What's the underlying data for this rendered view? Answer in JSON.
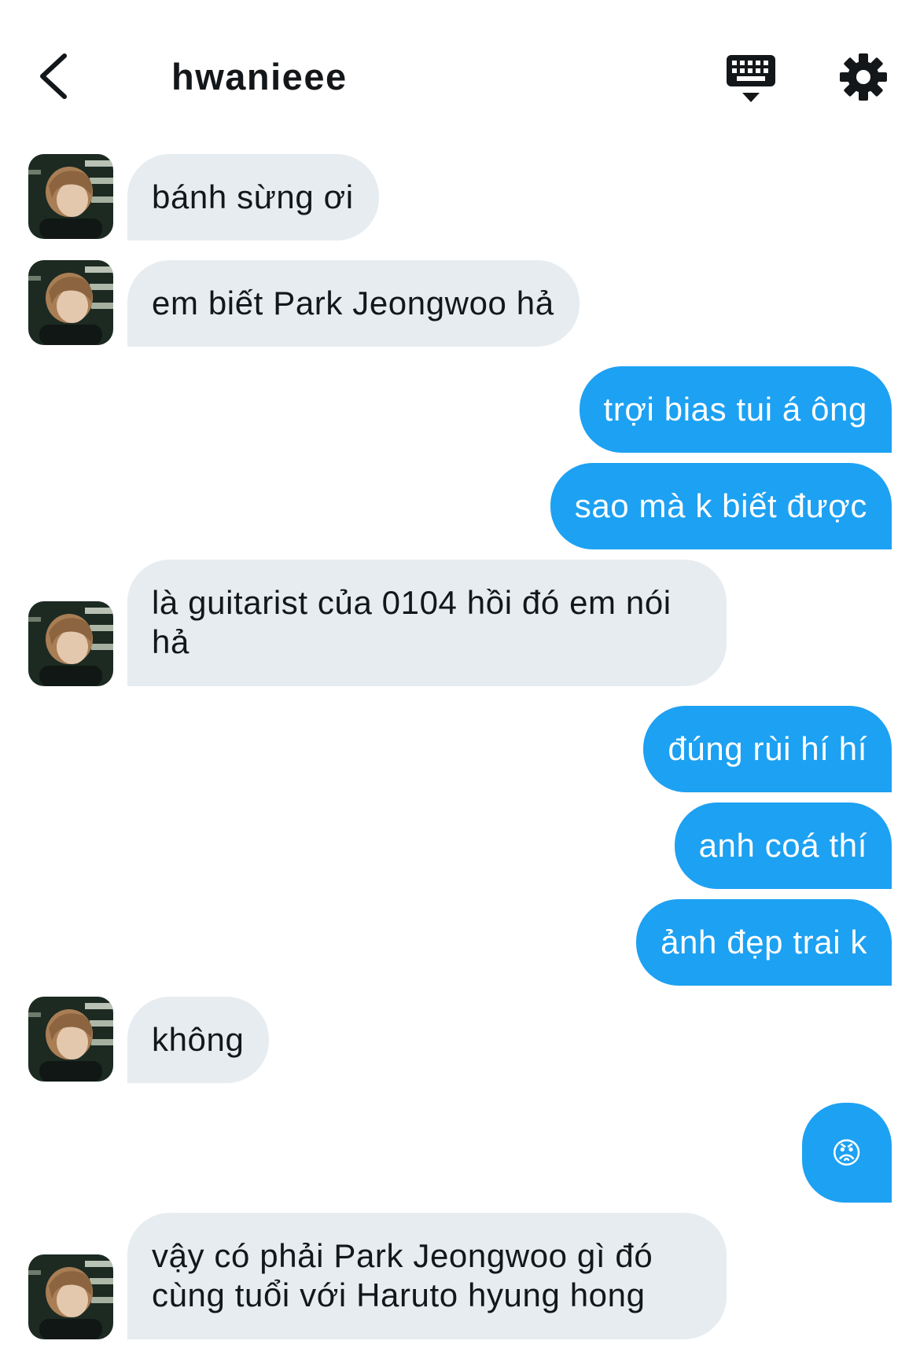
{
  "header": {
    "title": "hwanieee",
    "back_icon": "chevron-left-icon",
    "keyboard_icon": "keyboard-icon",
    "settings_icon": "gear-icon"
  },
  "colors": {
    "incoming_bubble": "#e6ecf0",
    "outgoing_bubble": "#1da1f2",
    "text": "#14171a"
  },
  "messages": [
    {
      "direction": "incoming",
      "text": "bánh sừng ơi"
    },
    {
      "direction": "incoming",
      "text": "em biết Park Jeongwoo hả"
    },
    {
      "direction": "outgoing",
      "text": "trợi bias tui á ông"
    },
    {
      "direction": "outgoing",
      "text": "sao mà k biết được"
    },
    {
      "direction": "incoming",
      "text": "là guitarist của 0104 hồi đó em nói hả"
    },
    {
      "direction": "outgoing",
      "text": "đúng rùi hí hí"
    },
    {
      "direction": "outgoing",
      "text": "anh coá thí"
    },
    {
      "direction": "outgoing",
      "text": "ảnh đẹp trai k"
    },
    {
      "direction": "incoming",
      "text": "không"
    },
    {
      "direction": "outgoing",
      "text": "😡",
      "emoji_icon": "angry-face-icon"
    },
    {
      "direction": "incoming",
      "text": "vậy có phải Park Jeongwoo gì đó cùng tuổi với Haruto hyung hong"
    }
  ]
}
